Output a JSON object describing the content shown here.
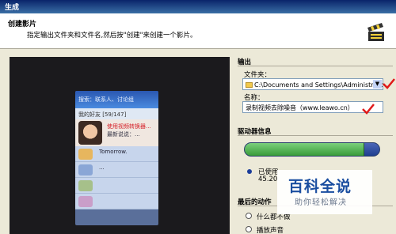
{
  "window": {
    "title": "生成"
  },
  "header": {
    "title": "创建影片",
    "subtitle": "指定输出文件夹和文件名,然后按\"创建\"来创建一个影片。"
  },
  "preview": {
    "search_text": "搜索：联系人、讨论组",
    "group_label": "我的好友 [59/147]",
    "rows": [
      {
        "name": "使用视频转换器...",
        "status": "最新说说：..."
      },
      {
        "name": "Tomorrow.",
        "status": ""
      },
      {
        "name": "...",
        "status": ""
      }
    ]
  },
  "output": {
    "section": "输出",
    "folder_label": "文件夹：",
    "folder_value": "C:\\Documents and Settings\\Administrator\\桌面",
    "name_label": "名称：",
    "name_value": "录制视频去除噪音（www.leawo.cn）"
  },
  "drive": {
    "section": "驱动器信息",
    "used_fraction": 0.89,
    "used_label": "已使用",
    "used_value": "45.20"
  },
  "after": {
    "section": "最后的动作",
    "option1": "什么都不做",
    "option2": "播放声音"
  },
  "watermark": {
    "big": "百科全说",
    "small": "助你轻松解决"
  },
  "colors": {
    "accent_check": "#e01a1a",
    "bar_used": "#3a9b3a",
    "bar_free": "#1f3f8f"
  }
}
